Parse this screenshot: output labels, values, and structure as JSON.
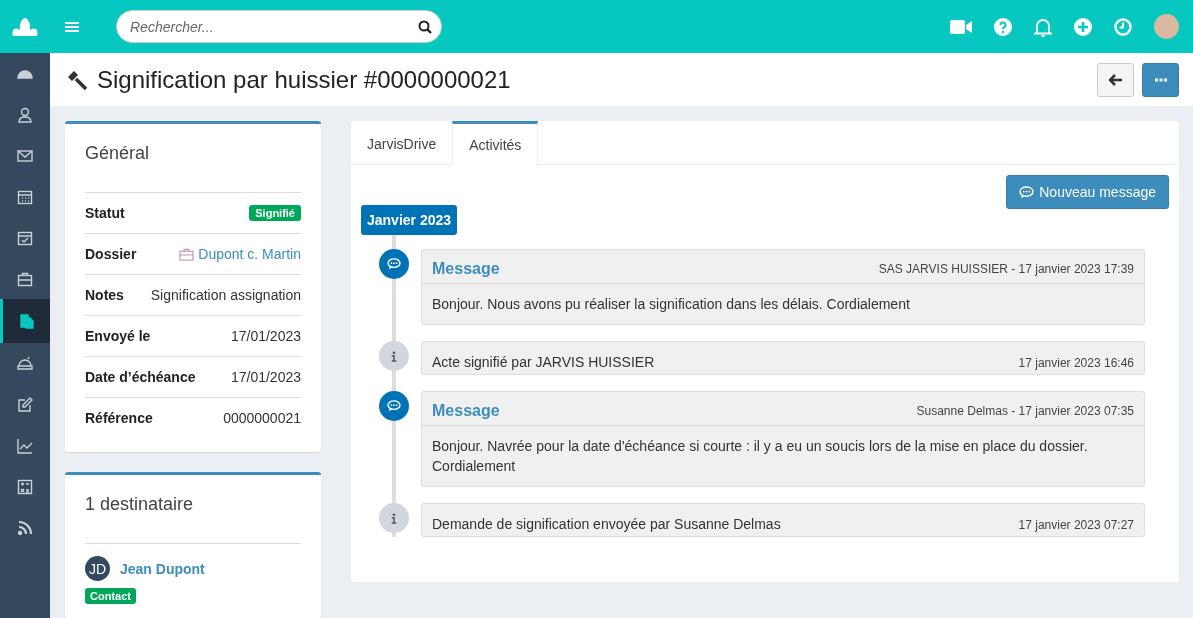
{
  "search": {
    "placeholder": "Rechercher..."
  },
  "sidebar": {
    "items": [
      {
        "kind": "dashboard",
        "selected": false
      },
      {
        "kind": "contacts",
        "selected": false
      },
      {
        "kind": "mail",
        "selected": false
      },
      {
        "kind": "calendar",
        "selected": false
      },
      {
        "kind": "tasks",
        "selected": false
      },
      {
        "kind": "briefcase",
        "selected": false
      },
      {
        "kind": "documents",
        "selected": true
      },
      {
        "kind": "bell",
        "selected": false
      },
      {
        "kind": "edit",
        "selected": false
      },
      {
        "kind": "chart",
        "selected": false
      },
      {
        "kind": "calculator",
        "selected": false
      },
      {
        "kind": "rss",
        "selected": false
      }
    ]
  },
  "page": {
    "title": "Signification par huissier #0000000021"
  },
  "general": {
    "title": "Général",
    "rows": [
      {
        "kind": "badge",
        "label": "Statut",
        "value": "Signifié"
      },
      {
        "kind": "link",
        "label": "Dossier",
        "value": "Dupont c. Martin"
      },
      {
        "kind": "text",
        "label": "Notes",
        "value": "Signification assignation"
      },
      {
        "kind": "text",
        "label": "Envoyé le",
        "value": "17/01/2023"
      },
      {
        "kind": "text",
        "label": "Date d’échéance",
        "value": "17/01/2023"
      },
      {
        "kind": "text",
        "label": "Référence",
        "value": "0000000021"
      }
    ]
  },
  "recipients": {
    "title": "1 destinataire",
    "items": [
      {
        "initials": "JD",
        "name": "Jean Dupont",
        "tag": "Contact"
      }
    ]
  },
  "tabs": [
    {
      "label": "JarvisDrive",
      "selected": false
    },
    {
      "label": "Activités",
      "selected": true
    }
  ],
  "new_message_button": "Nouveau message",
  "timeline": {
    "month": "Janvier 2023",
    "entries": [
      {
        "kind": "message",
        "title": "Message",
        "meta": "SAS JARVIS HUISSIER - 17 janvier 2023 17:39",
        "body": "Bonjour. Nous avons pu réaliser la signification dans les délais. Cordialement"
      },
      {
        "kind": "info",
        "body": "Acte signifié par JARVIS HUISSIER",
        "meta": "17 janvier 2023 16:46"
      },
      {
        "kind": "message",
        "title": "Message",
        "meta": "Susanne Delmas - 17 janvier 2023 07:35",
        "body": "Bonjour. Navrée pour la date d'échéance si courte : il y a eu un soucis lors de la mise en place du dossier. Cordialement"
      },
      {
        "kind": "info",
        "body": "Demande de signification envoyée par Susanne Delmas",
        "meta": "17 janvier 2023 07:27"
      }
    ]
  }
}
